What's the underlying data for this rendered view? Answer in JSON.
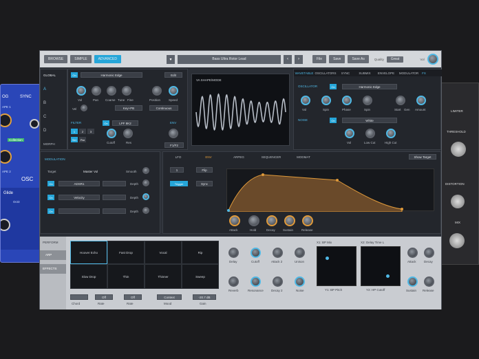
{
  "left_bg": {
    "labels": [
      "OG",
      "SYNC",
      "APE 1",
      "APE 2",
      "OSC",
      "Glide",
      "Collection",
      "Oct3"
    ]
  },
  "right_bg": {
    "labels": [
      "LIMITER",
      "THRESHOLD",
      "DISTORTION",
      "MIX"
    ]
  },
  "topbar": {
    "tabs": [
      "BROWSE",
      "SIMPLE",
      "ADVANCED"
    ],
    "patch_name": "Bass Ultra Rotor Lead",
    "buttons": [
      "File",
      "Save",
      "Save As"
    ],
    "quality_label": "Quality",
    "quality_value": "Great",
    "vol_label": "Vol"
  },
  "sidebar": {
    "items": [
      "GLOBAL",
      "A",
      "B",
      "C",
      "D",
      "MORPH"
    ]
  },
  "osc_a": {
    "on": "On",
    "mode": "Harmonic Edge",
    "edit": "Edit",
    "knobs": [
      "Vol",
      "Pan",
      "Coarse",
      "Tune",
      "Fine",
      "Position",
      "Speed"
    ],
    "vel": "Vel",
    "key_mode": "Key+PB",
    "cont_mode": "Continuous",
    "filter": "FILTER",
    "filter_type": "LPF 8K2",
    "fx_label": "Lfo",
    "cutoff": "Cutoff",
    "res": "Res",
    "env": "ENV",
    "env_val": "F1/F2"
  },
  "wave": {
    "title": "VA SHAPE/MODE"
  },
  "right_top": {
    "tabs": [
      "WAVETABLE",
      "OSCILLATORS",
      "SYNC",
      "SUBMIX",
      "ENVELOPE",
      "MODULATOR",
      "FX"
    ],
    "osc_label": "OSCILLATOR",
    "on": "On",
    "mode": "Harmonic Edge",
    "knobs": [
      "Vol",
      "Spin",
      "Phase",
      "Spin",
      "Start",
      "Gen",
      "Amount"
    ],
    "noise": "NOISE",
    "noise_on": "On",
    "noise_type": "White",
    "noise_knobs": [
      "Vol",
      "Low Cut",
      "High Cut"
    ]
  },
  "modulation": {
    "title": "MODULATION",
    "target_label": "Target",
    "target": "Master Vol",
    "smooth": "Smooth",
    "rows": [
      {
        "on": "On",
        "source": "ADSR1",
        "depth": "Depth"
      },
      {
        "on": "On",
        "source": "Velocity",
        "depth": "Depth"
      },
      {
        "on": "On",
        "source": "",
        "depth": "Depth"
      }
    ]
  },
  "env_tabs": [
    "LFO",
    "ENV",
    "ARPEG",
    "SEQUENCER",
    "MODMAT"
  ],
  "env_ctrl": {
    "val": "1",
    "flip": "Flip",
    "trigger": "Trigger",
    "sync": "Sync",
    "show_target": "Show Target"
  },
  "env_knobs": [
    "Attack",
    "Hold",
    "Decay",
    "Sustain",
    "Release"
  ],
  "bottom": {
    "side_tabs": [
      "PERFORM",
      "ARP",
      "EFFECTS"
    ],
    "pads": [
      "Hoover Echo",
      "Fast Drop",
      "Vocal",
      "Rip",
      "Slow Drop",
      "Thin",
      "Thinner",
      "Sweep"
    ],
    "selectors": [
      {
        "value": "",
        "label": "Chord"
      },
      {
        "value": "Off",
        "label": "Rate"
      },
      {
        "value": "Off",
        "label": "Rate"
      },
      {
        "value": "Context",
        "label": "Mood"
      },
      {
        "value": "-20.7 dB",
        "label": "Gain"
      }
    ],
    "knobs_row1": [
      "Delay",
      "Cutoff",
      "Attack 2",
      "Unison"
    ],
    "knobs_row2": [
      "Reverb",
      "Resonance",
      "Decay 2",
      "Noise"
    ],
    "xy1_top": "X1: BP Mix",
    "xy1_bottom": "Y1: BP Pitch",
    "xy2_top": "X2: Delay Time L",
    "xy2_bottom": "Y2: HP Cutoff",
    "right_knobs": [
      "Attack",
      "Decay",
      "Sustain",
      "Release"
    ]
  }
}
